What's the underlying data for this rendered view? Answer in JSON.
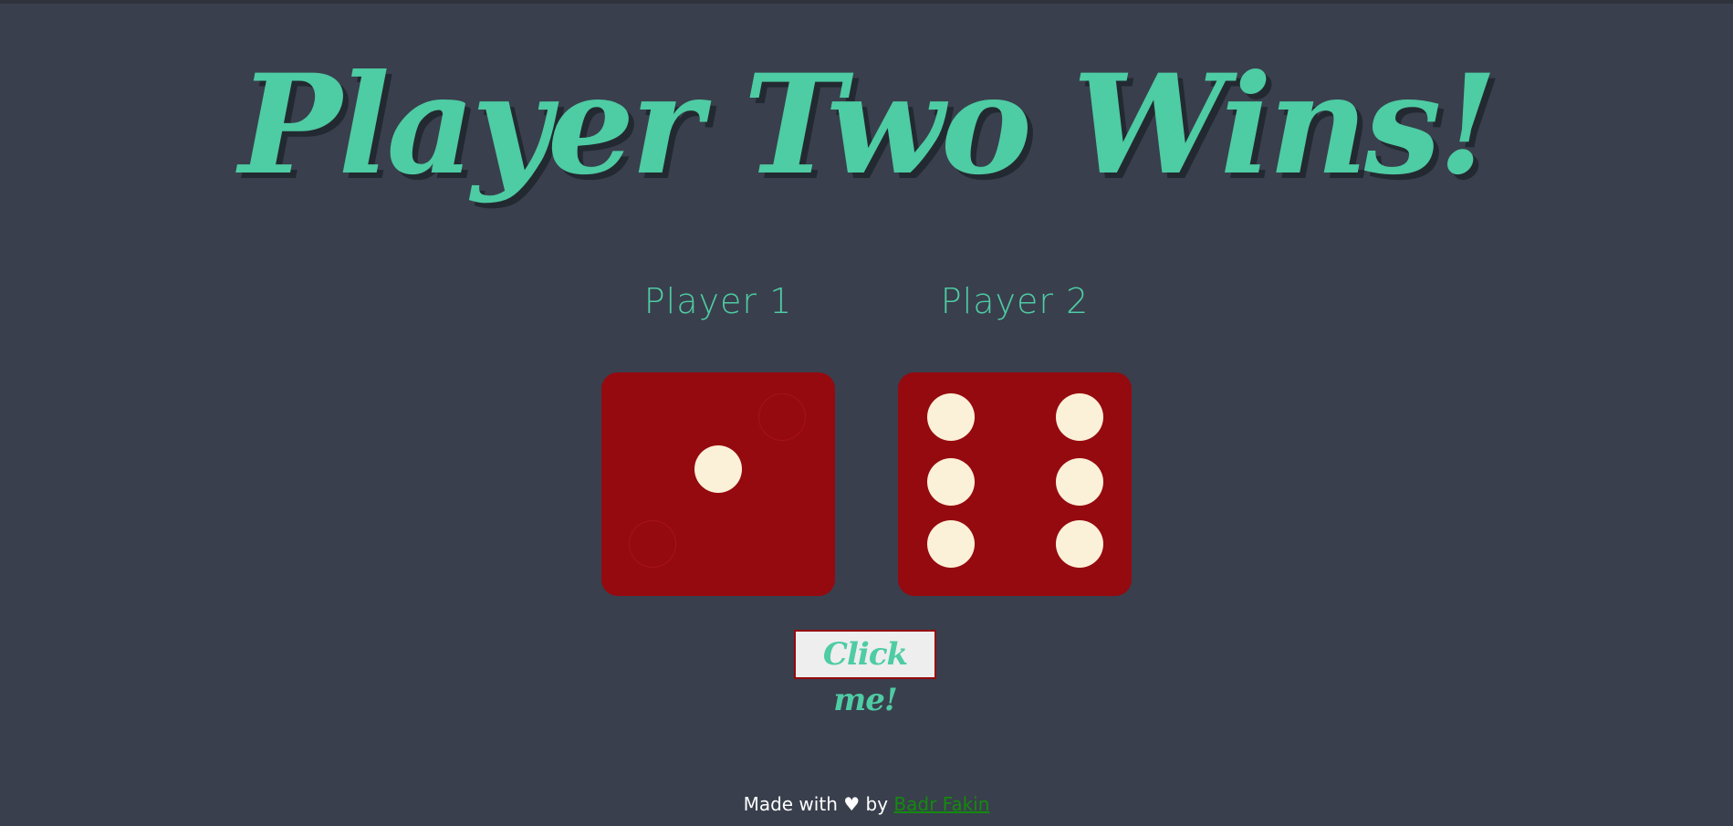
{
  "title": "Player Two Wins!",
  "players": [
    {
      "label": "Player 1",
      "die_value": 1
    },
    {
      "label": "Player 2",
      "die_value": 6
    }
  ],
  "button": {
    "label": "Click me!"
  },
  "footer": {
    "prefix": "Made with",
    "heart_icon": "heart-icon",
    "middle": "by",
    "author": "Badr Fakin"
  },
  "colors": {
    "background": "#393f4d",
    "accent": "#4ecca3",
    "die": "#950a0f",
    "pip": "#fbf1d8",
    "link": "#138a0d"
  }
}
